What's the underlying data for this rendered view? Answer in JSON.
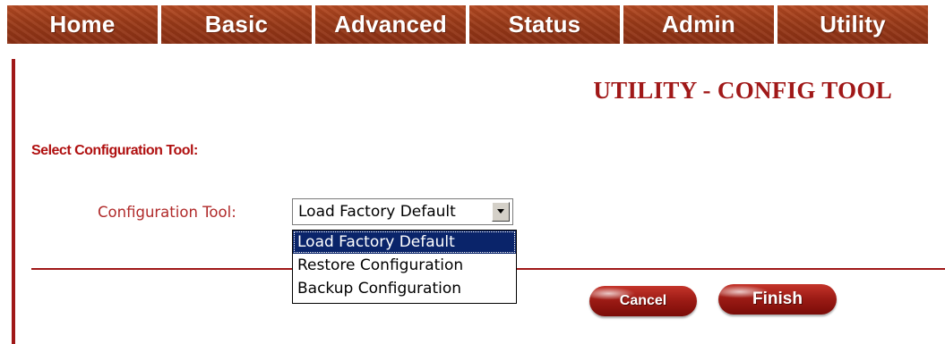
{
  "nav": {
    "tabs": [
      {
        "label": "Home"
      },
      {
        "label": "Basic"
      },
      {
        "label": "Advanced"
      },
      {
        "label": "Status"
      },
      {
        "label": "Admin"
      },
      {
        "label": "Utility"
      }
    ]
  },
  "main": {
    "title": "UTILITY - CONFIG TOOL",
    "section_heading": "Select Configuration Tool:",
    "field_label": "Configuration Tool:",
    "select_value": "Load Factory Default",
    "options": [
      {
        "label": "Load Factory Default",
        "selected": true
      },
      {
        "label": "Restore Configuration",
        "selected": false
      },
      {
        "label": "Backup Configuration",
        "selected": false
      }
    ]
  },
  "buttons": {
    "cancel": "Cancel",
    "finish": "Finish"
  },
  "colors": {
    "accent": "#a01818",
    "nav_tab": "#9a3a18",
    "selection": "#0a246a"
  }
}
